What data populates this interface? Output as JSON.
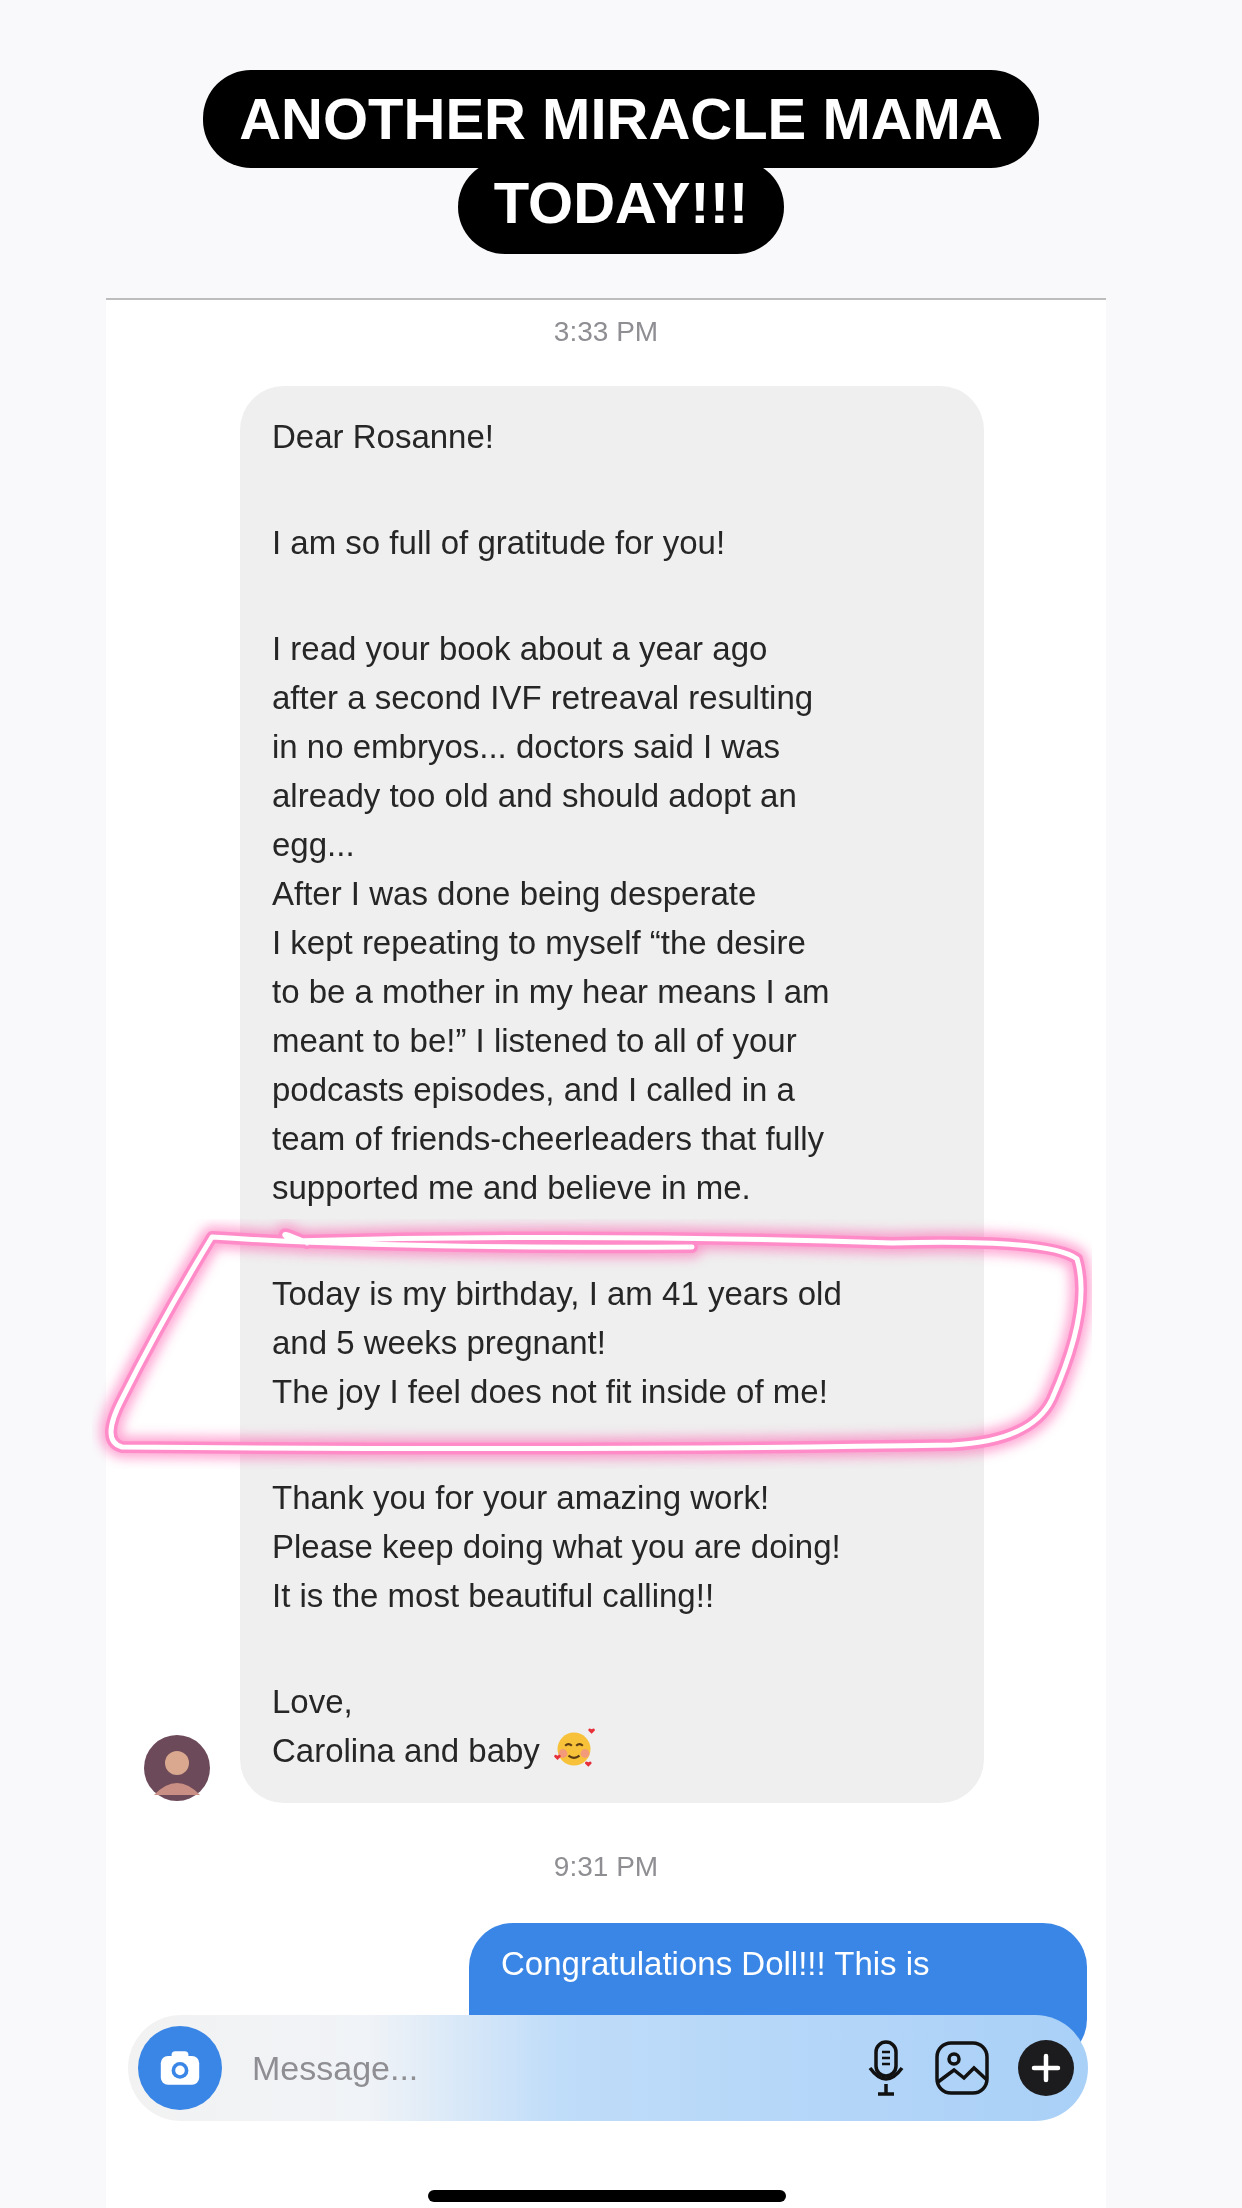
{
  "caption": {
    "lines": [
      "ANOTHER MIRACLE MAMA",
      "TODAY!!!"
    ]
  },
  "messages": [
    {
      "kind": "time",
      "text": "3:33 PM"
    },
    {
      "kind": "received",
      "paragraphs": [
        [
          "Dear Rosanne!"
        ],
        [
          "I am so full of gratitude for you!"
        ],
        [
          "I read your book about a year ago",
          "after a second IVF retreaval resulting",
          "in no embryos... doctors said I was",
          "already too old and should adopt an",
          "egg...",
          "After I was done being desperate",
          "I kept repeating to myself “the desire",
          "to be a mother in my hear means I am",
          "meant to be!” I listened to all of your",
          "podcasts episodes, and I called in a",
          "team of friends-cheerleaders that fully",
          "supported me and believe in me."
        ],
        [
          "Today is my birthday, I am 41 years old",
          "and 5 weeks pregnant!",
          "The joy I feel does not fit inside of me!"
        ],
        [
          "Thank you for your amazing work!",
          "Please keep doing what you are doing!",
          "It is the most beautiful calling!!"
        ],
        [
          "Love,",
          "Carolina and baby"
        ]
      ]
    },
    {
      "kind": "time",
      "text": "9:31 PM"
    },
    {
      "kind": "sent",
      "paragraphs": [
        [
          "Congratulations Doll!!! This is"
        ]
      ]
    }
  ],
  "composer": {
    "placeholder": "Message..."
  }
}
